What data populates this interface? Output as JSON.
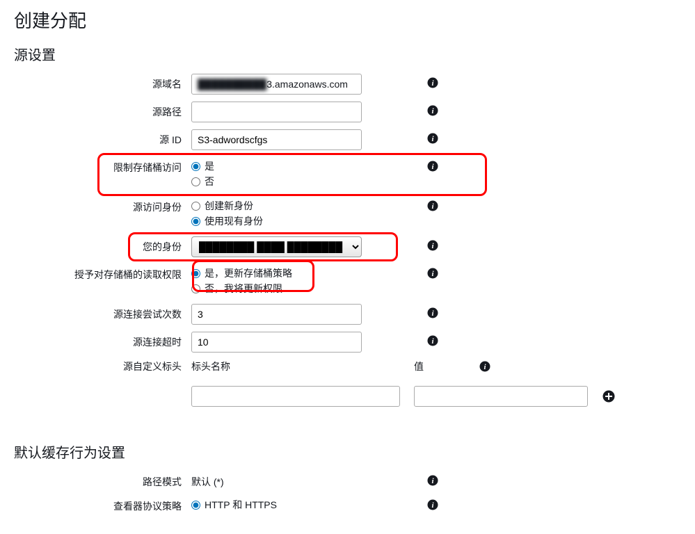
{
  "page": {
    "title": "创建分配"
  },
  "origin_settings": {
    "heading": "源设置",
    "domain_label": "源域名",
    "domain_value_blurred": "██████████",
    "domain_value_suffix": "3.amazonaws.com",
    "path_label": "源路径",
    "path_value": "",
    "id_label": "源 ID",
    "id_value": "S3-adwordscfgs",
    "restrict_bucket_label": "限制存储桶访问",
    "restrict_yes": "是",
    "restrict_no": "否",
    "oai_label": "源访问身份",
    "oai_create": "创建新身份",
    "oai_use_existing": "使用现有身份",
    "your_identity_label": "您的身份",
    "your_identity_value_blurred": "██████████████████",
    "grant_read_label": "授予对存储桶的读取权限",
    "grant_read_yes": "是，更新存储桶策略",
    "grant_read_no": "否，我将更新权限",
    "conn_attempts_label": "源连接尝试次数",
    "conn_attempts_value": "3",
    "conn_timeout_label": "源连接超时",
    "conn_timeout_value": "10",
    "custom_headers_label": "源自定义标头",
    "header_name_col": "标头名称",
    "header_value_col": "值"
  },
  "cache_behavior": {
    "heading": "默认缓存行为设置",
    "path_pattern_label": "路径模式",
    "path_pattern_value": "默认 (*)",
    "viewer_protocol_label": "查看器协议策略",
    "viewer_protocol_http_https": "HTTP 和 HTTPS"
  }
}
